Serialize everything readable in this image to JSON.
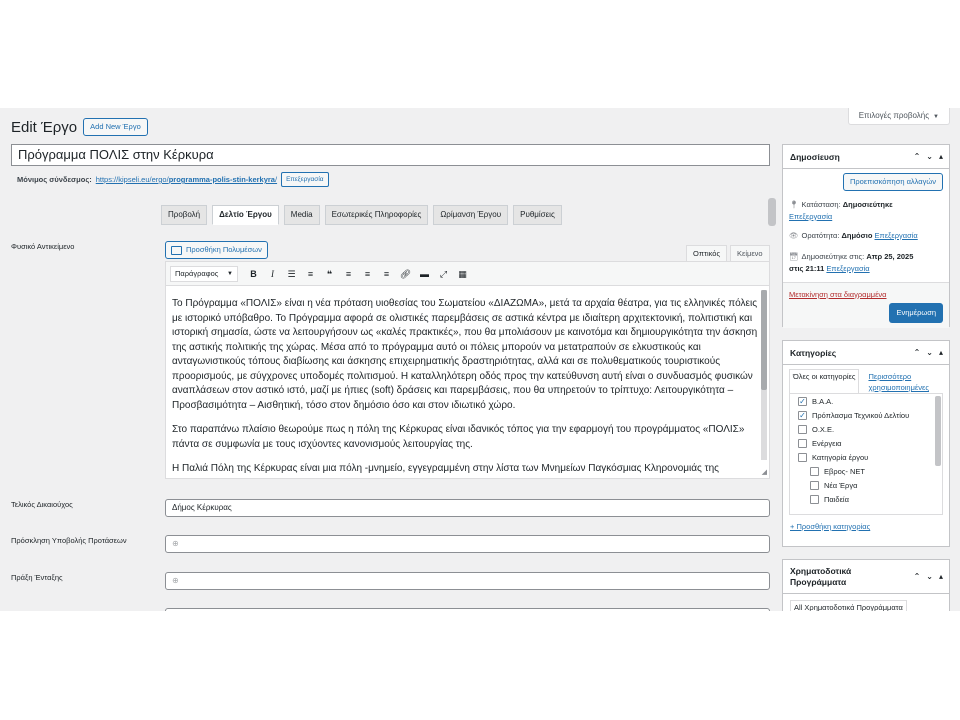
{
  "screen_options": "Επιλογές προβολής",
  "page_title": "Edit Έργο",
  "add_new_label": "Add New Έργο",
  "post_title": "Πρόγραμμα ΠΟΛΙΣ στην Κέρκυρα",
  "permalink": {
    "label": "Μόνιμος σύνδεσμος:",
    "base": "https://kipseli.eu/ergo/",
    "slug": "programma-polis-stin-kerkyra",
    "trail": "/",
    "edit": "Επεξεργασία"
  },
  "tabs": [
    "Προβολή",
    "Δελτίο Έργου",
    "Media",
    "Εσωτερικές Πληροφορίες",
    "Ωρίμανση Έργου",
    "Ρυθμίσεις"
  ],
  "fields": {
    "physical_object": "Φυσικό Αντικείμενο",
    "beneficiary": "Τελικός Δικαιούχος",
    "beneficiary_value": "Δήμος Κέρκυρας",
    "call": "Πρόσκληση Υποβολής Προτάσεων",
    "inclusion": "Πράξη Ένταξης"
  },
  "editor": {
    "add_media": "Προσθήκη Πολυμέσων",
    "tab_visual": "Οπτικός",
    "tab_text": "Κείμενο",
    "format": "Παράγραφος",
    "paragraphs": [
      "Το  Πρόγραμμα «ΠΟΛΙΣ» είναι η νέα πρόταση υιοθεσίας του Σωματείου «ΔΙΑΖΩΜΑ», μετά τα αρχαία θέατρα, για τις ελληνικές πόλεις με ιστορικό υπόβαθρο. Το Πρόγραμμα αφορά σε ολιστικές παρεμβάσεις σε αστικά κέντρα με ιδιαίτερη αρχιτεκτονική, πολιτιστική και ιστορική σημασία, ώστε να λειτουργήσουν ως «καλές πρακτικές», που θα μπολιάσουν με καινοτόμα και δημιουργικότητα την άσκηση της αστικής πολιτικής της χώρας. Μέσα από το πρόγραμμα αυτό οι πόλεις μπορούν να μετατραπούν σε ελκυστικούς και ανταγωνιστικούς τόπους διαβίωσης και άσκησης επιχειρηματικής δραστηριότητας, αλλά και σε πολυθεματικούς τουριστικούς προορισμούς, με σύγχρονες υποδομές πολιτισμού. Η καταλληλότερη οδός προς την κατεύθυνση αυτή είναι ο συνδυασμός φυσικών αναπλάσεων στον αστικό ιστό, μαζί με ήπιες (soft) δράσεις και παρεμβάσεις, που θα υπηρετούν το τρίπτυχο: Λειτουργικότητα – Προσβασιμότητα – Αισθητική, τόσο στον δημόσιο όσο και στον ιδιωτικό χώρο.",
      "Στο παραπάνω πλαίσιο  θεωρούμε πως η πόλη της Κέρκυρας είναι ιδανικός τόπος για την εφαρμογή του προγράμματος «ΠΟΛΙΣ» πάντα σε συμφωνία με τους ισχύοντες κανονισμούς λειτουργίας της.",
      "Η Παλιά Πόλη της Κέρκυρας είναι μια πόλη -μνημείο, εγγεγραμμένη στην λίστα των Μνημείων Παγκόσμιας Κληρονομιάς της UNESCO"
    ]
  },
  "publish": {
    "title": "Δημοσίευση",
    "preview": "Προεπισκόπηση αλλαγών",
    "status_label": "Κατάσταση:",
    "status_value": "Δημοσιεύτηκε",
    "visibility_label": "Ορατότητα:",
    "visibility_value": "Δημόσιο",
    "published_label": "Δημοσιεύτηκε στις:",
    "published_value": "Απρ 25, 2025",
    "published_time": "στις 21:11",
    "edit": "Επεξεργασία",
    "trash": "Μετακίνηση στα διαγραμμένα",
    "update": "Ενημέρωση"
  },
  "categories": {
    "title": "Κατηγορίες",
    "tab_all": "Όλες οι κατηγορίες",
    "tab_popular": "Περισσότερο χρησιμοποιημένες",
    "items": [
      {
        "label": "Β.Α.Α.",
        "checked": true,
        "child": false
      },
      {
        "label": "Πρόπλασμα Τεχνικού Δελτίου",
        "checked": true,
        "child": false
      },
      {
        "label": "Ο.Χ.Ε.",
        "checked": false,
        "child": false
      },
      {
        "label": "Ενέργεια",
        "checked": false,
        "child": false
      },
      {
        "label": "Κατηγορία έργου",
        "checked": false,
        "child": false
      },
      {
        "label": "Εβρος- ΝΕΤ",
        "checked": false,
        "child": true
      },
      {
        "label": "Νέα Έργα",
        "checked": false,
        "child": true
      },
      {
        "label": "Παιδεία",
        "checked": false,
        "child": true
      }
    ],
    "add_new": "+ Προσθήκη κατηγορίας"
  },
  "funding": {
    "title": "Χρηματοδοτικά Προγράμματα",
    "tab_all": "All Χρηματοδοτικά Προγράμματα"
  },
  "colors": {
    "accent": "#2271b1",
    "danger": "#b32d2e"
  }
}
